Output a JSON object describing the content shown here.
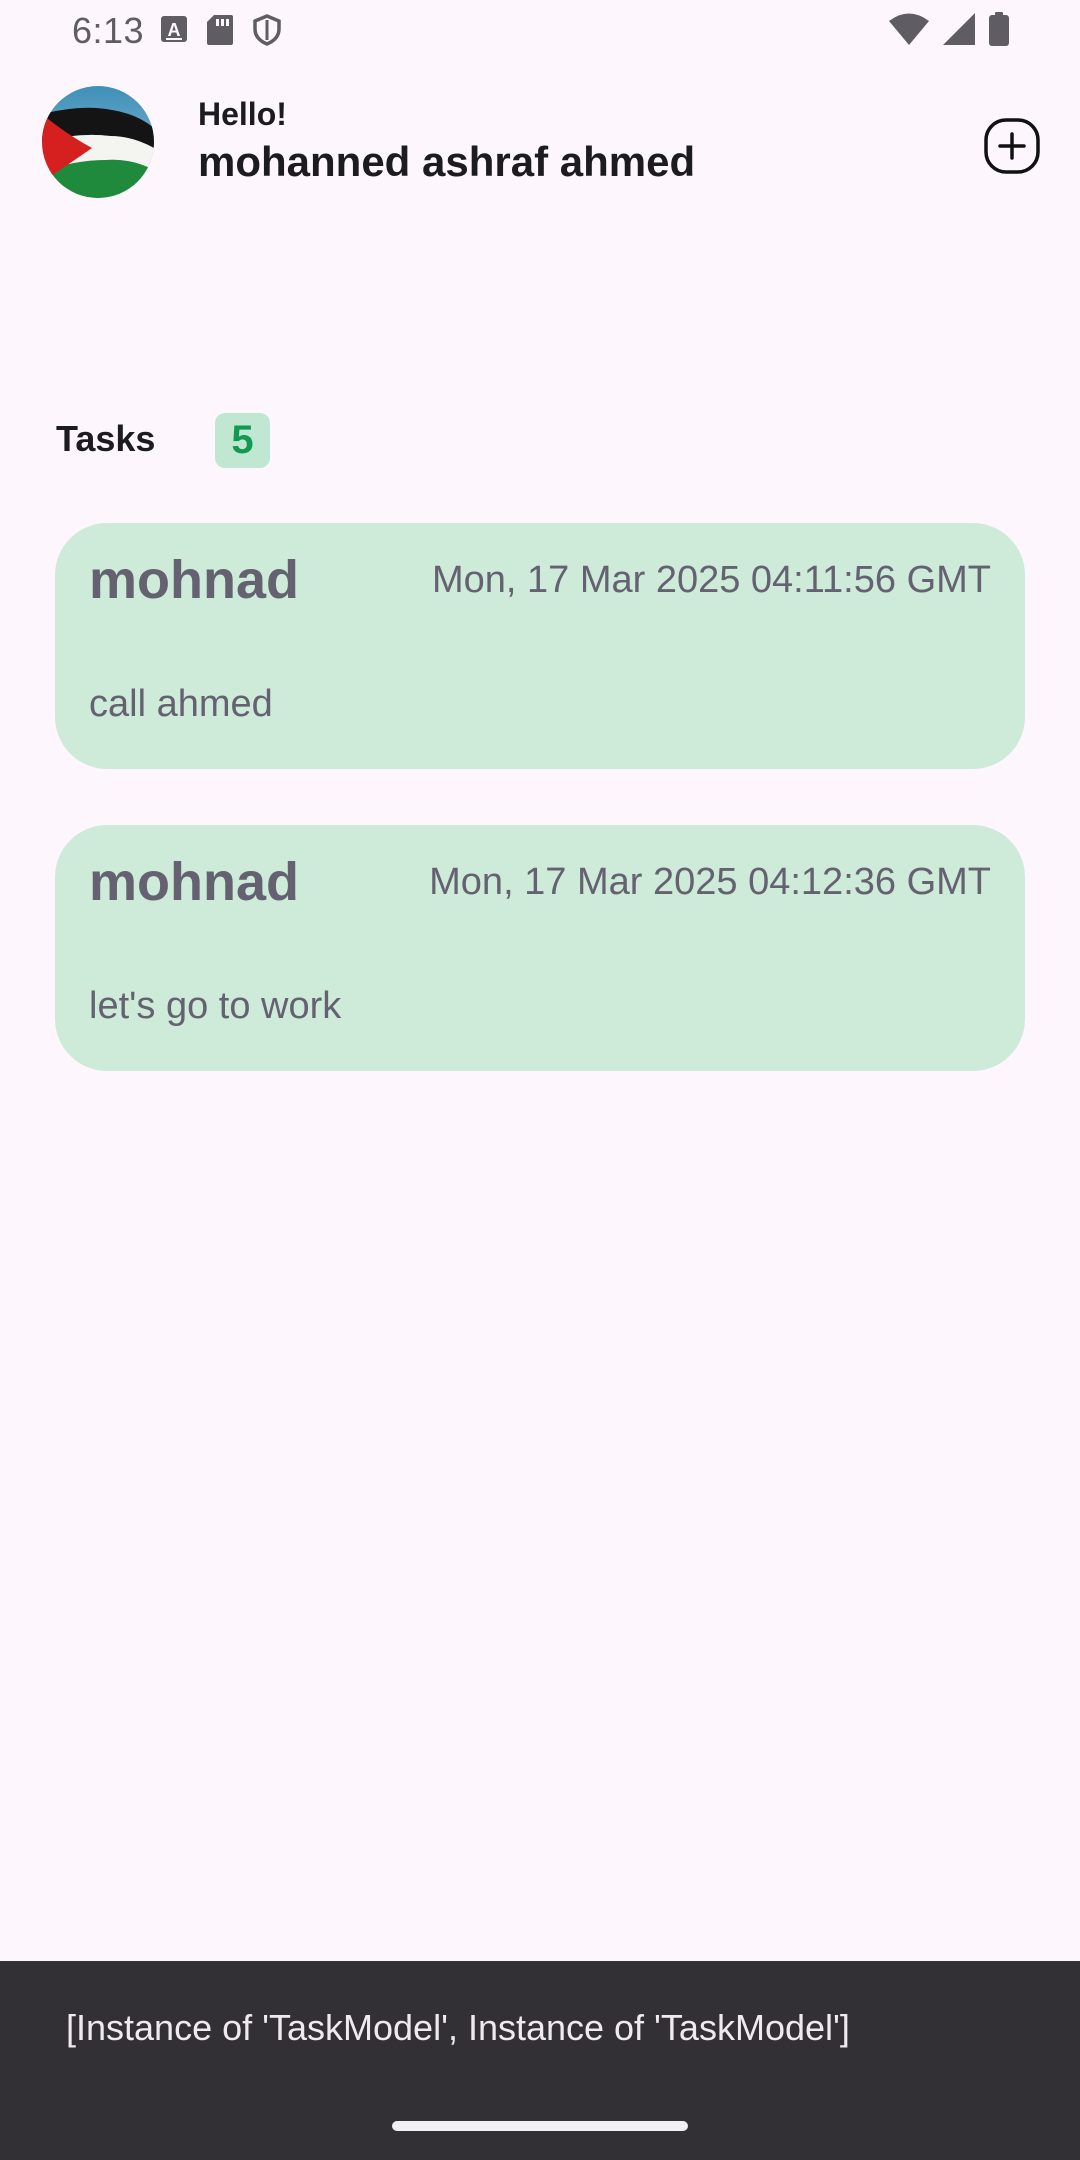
{
  "status_bar": {
    "time": "6:13",
    "left_icons": [
      "a-keyboard-icon",
      "sd-card-icon",
      "shield-icon"
    ],
    "right_icons": [
      "wifi-icon",
      "cell-signal-icon",
      "battery-icon"
    ]
  },
  "header": {
    "greeting": "Hello!",
    "user_name": "mohanned ashraf ahmed",
    "avatar_icon": "palestine-flag-avatar",
    "add_icon": "add-circle-icon"
  },
  "tasks": {
    "title": "Tasks",
    "count": "5",
    "items": [
      {
        "title": "mohnad",
        "date": "Mon, 17 Mar 2025 04:11:56 GMT",
        "description": "call ahmed"
      },
      {
        "title": "mohnad",
        "date": "Mon, 17 Mar 2025 04:12:36 GMT",
        "description": "let's go to work"
      }
    ]
  },
  "snackbar": {
    "message": "[Instance of 'TaskModel', Instance of 'TaskModel']"
  },
  "colors": {
    "background": "#FDF7FD",
    "card": "#CEEBD9",
    "badge_bg": "#BFE7D1",
    "badge_text": "#129A52",
    "snackbar": "#323035"
  }
}
